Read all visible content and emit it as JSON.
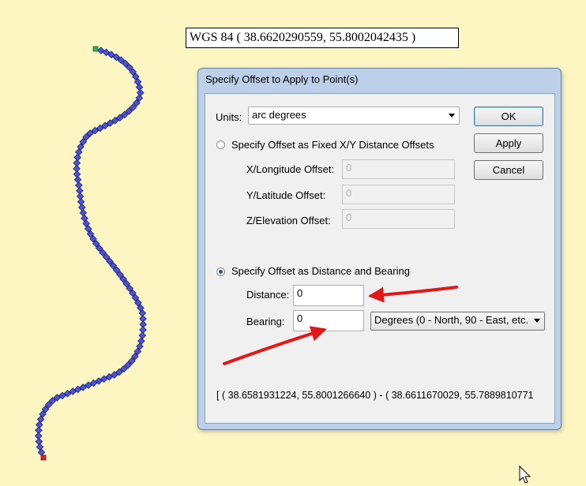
{
  "map": {
    "coordinate_label": "WGS 84 ( 38.6620290559, 55.8002042435 )",
    "track_colors": {
      "line": "#e00000",
      "point": "#4a55d6",
      "start": "#2fb34a",
      "end": "#e02020"
    }
  },
  "dialog": {
    "title": "Specify Offset to Apply to Point(s)",
    "units_label": "Units:",
    "units_value": "arc degrees",
    "buttons": {
      "ok": "OK",
      "apply": "Apply",
      "cancel": "Cancel"
    },
    "fixed_offset": {
      "label": "Specify Offset as Fixed X/Y Distance Offsets",
      "selected": false,
      "x_label": "X/Longitude Offset:",
      "x_value": "0",
      "y_label": "Y/Latitude Offset:",
      "y_value": "0",
      "z_label": "Z/Elevation Offset:",
      "z_value": "0"
    },
    "distance_bearing": {
      "label": "Specify Offset as Distance and Bearing",
      "selected": true,
      "distance_label": "Distance:",
      "distance_value": "0",
      "bearing_label": "Bearing:",
      "bearing_value": "0",
      "bearing_units": "Degrees (0 - North, 90 - East, etc."
    },
    "bounds_text": "[ ( 38.6581931224, 55.8001266640 ) - ( 38.6611670029, 55.7889810771"
  },
  "annotation_colors": {
    "arrow": "#e01818"
  }
}
